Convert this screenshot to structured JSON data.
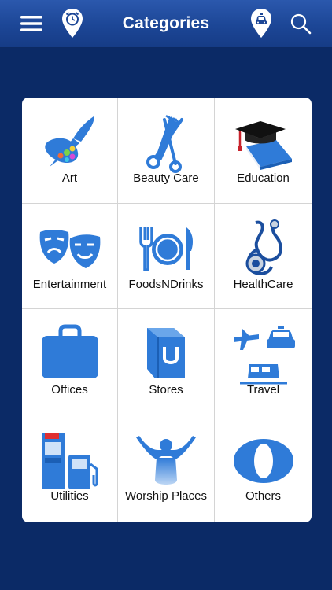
{
  "header": {
    "title": "Categories"
  },
  "icons": {
    "menu": "hamburger-menu-icon",
    "alarm": "alarm-location-pin-icon",
    "taxi": "taxi-location-pin-icon",
    "search": "search-icon"
  },
  "colors": {
    "topbar": "#1c4696",
    "background": "#0b2a66",
    "icon_blue": "#2f7bd8"
  },
  "categories": [
    {
      "label": "Art",
      "icon": "paintbrush-palette-icon"
    },
    {
      "label": "Beauty Care",
      "icon": "scissors-comb-icon"
    },
    {
      "label": "Education",
      "icon": "graduation-cap-book-icon"
    },
    {
      "label": "Entertainment",
      "icon": "theater-masks-icon"
    },
    {
      "label": "FoodsNDrinks",
      "icon": "fork-plate-knife-icon"
    },
    {
      "label": "HealthCare",
      "icon": "stethoscope-icon"
    },
    {
      "label": "Offices",
      "icon": "briefcase-icon"
    },
    {
      "label": "Stores",
      "icon": "shopping-bag-icon"
    },
    {
      "label": "Travel",
      "icon": "plane-taxi-train-icon"
    },
    {
      "label": "Utilities",
      "icon": "atm-fuel-pump-icon"
    },
    {
      "label": "Worship Places",
      "icon": "raised-hands-person-icon"
    },
    {
      "label": "Others",
      "icon": "circle-o-icon"
    }
  ]
}
